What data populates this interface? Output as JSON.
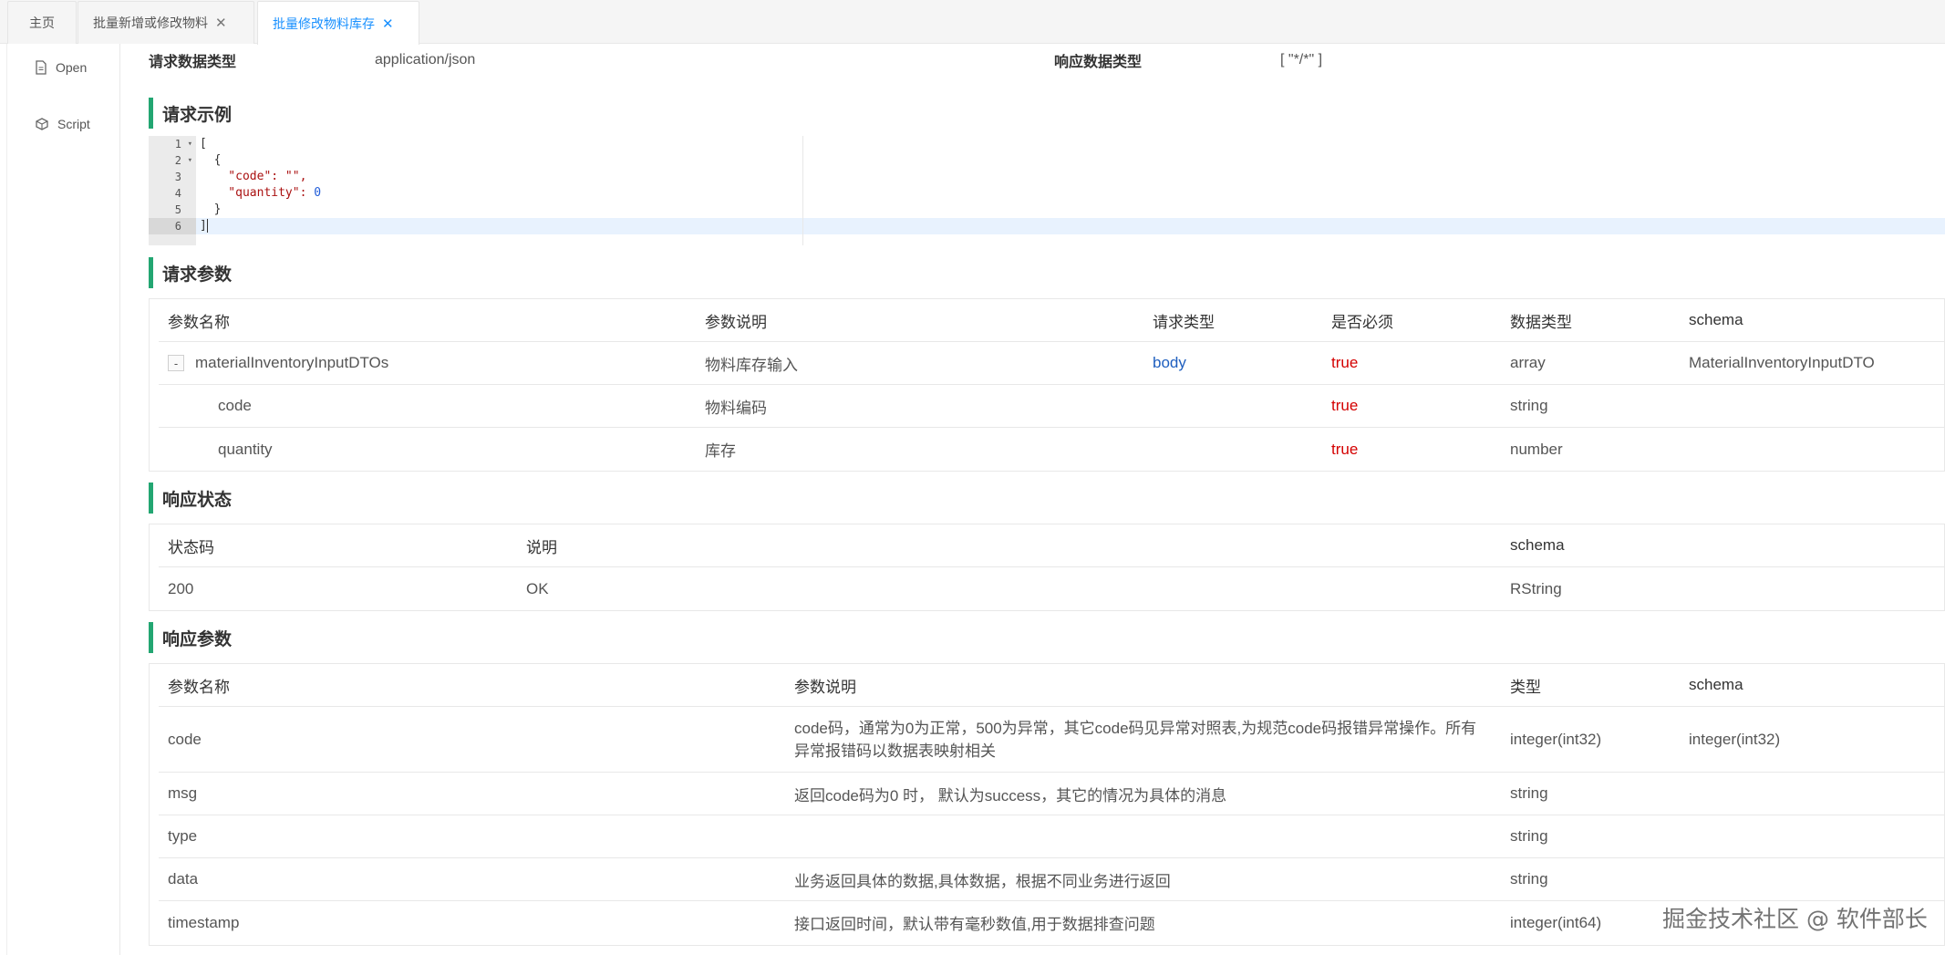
{
  "tabs": [
    {
      "label": "主页",
      "closable": false,
      "active": false
    },
    {
      "label": "批量新增或修改物料",
      "closable": true,
      "active": false
    },
    {
      "label": "批量修改物料库存",
      "closable": true,
      "active": true
    }
  ],
  "sidebar": {
    "items": [
      {
        "label": "Open",
        "icon": "document-icon"
      },
      {
        "label": "Script",
        "icon": "code-icon"
      }
    ]
  },
  "meta": {
    "request_type_label": "请求数据类型",
    "request_type_value": "application/json",
    "response_type_label": "响应数据类型",
    "response_type_value": "[ \"*/*\" ]"
  },
  "sections": {
    "request_example": "请求示例",
    "request_params": "请求参数",
    "response_status": "响应状态",
    "response_params": "响应参数"
  },
  "code": {
    "line_numbers": [
      "1",
      "2",
      "3",
      "4",
      "5",
      "6"
    ],
    "lines": [
      "[",
      "  {",
      "    \"code\": \"\",",
      "    \"quantity\": 0",
      "  }",
      "]"
    ]
  },
  "request_params": {
    "headers": [
      "参数名称",
      "参数说明",
      "请求类型",
      "是否必须",
      "数据类型",
      "schema"
    ],
    "rows": [
      {
        "name": "materialInventoryInputDTOs",
        "desc": "物料库存输入",
        "in": "body",
        "required": "true",
        "type": "array",
        "schema": "MaterialInventoryInputDTO",
        "expander": "-"
      },
      {
        "name": "code",
        "desc": "物料编码",
        "in": "",
        "required": "true",
        "type": "string",
        "schema": ""
      },
      {
        "name": "quantity",
        "desc": "库存",
        "in": "",
        "required": "true",
        "type": "number",
        "schema": ""
      }
    ]
  },
  "response_status": {
    "headers": [
      "状态码",
      "说明",
      "schema"
    ],
    "rows": [
      {
        "code": "200",
        "desc": "OK",
        "schema": "RString"
      }
    ]
  },
  "response_params": {
    "headers": [
      "参数名称",
      "参数说明",
      "类型",
      "schema"
    ],
    "rows": [
      {
        "name": "code",
        "desc": "code码，通常为0为正常，500为异常，其它code码见异常对照表,为规范code码报错异常操作。所有异常报错码以数据表映射相关",
        "type": "integer(int32)",
        "schema": "integer(int32)"
      },
      {
        "name": "msg",
        "desc": "返回code码为0 时， 默认为success，其它的情况为具体的消息",
        "type": "string",
        "schema": ""
      },
      {
        "name": "type",
        "desc": "",
        "type": "string",
        "schema": ""
      },
      {
        "name": "data",
        "desc": "业务返回具体的数据,具体数据，根据不同业务进行返回",
        "type": "string",
        "schema": ""
      },
      {
        "name": "timestamp",
        "desc": "接口返回时间，默认带有毫秒数值,用于数据排查问题",
        "type": "integer(int64)",
        "schema": ""
      }
    ]
  },
  "watermark": "掘金技术社区 @ 软件部长",
  "colors": {
    "accent_green": "#23a672",
    "link_blue": "#1890ff",
    "required_red": "#d40000",
    "body_blue": "#1f5fbf"
  }
}
